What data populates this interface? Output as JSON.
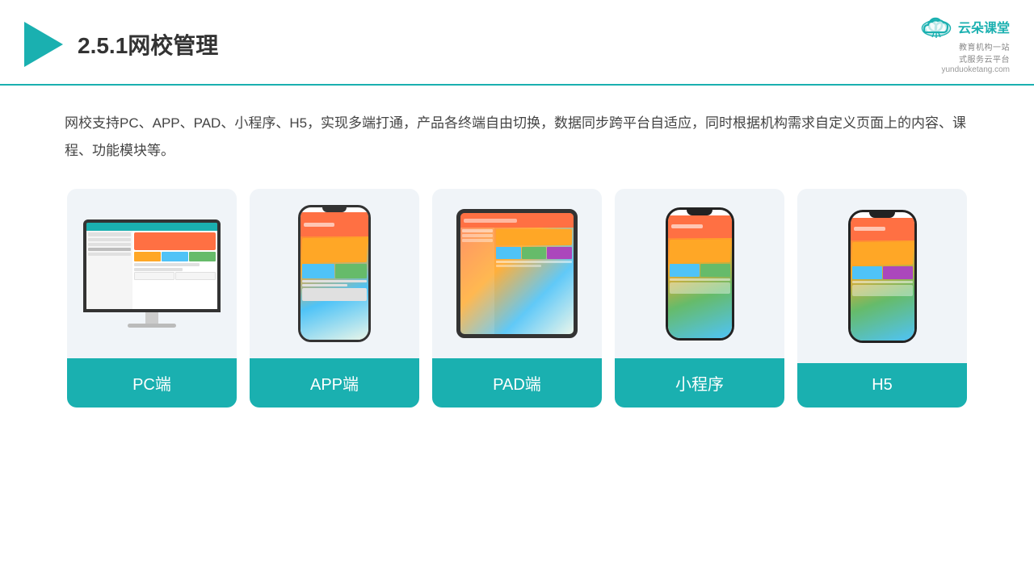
{
  "header": {
    "title": "2.5.1网校管理",
    "brand": {
      "name": "云朵课堂",
      "sub": "教育机构一站\n式服务云平台",
      "url": "yunduoketang.com"
    }
  },
  "description": "网校支持PC、APP、PAD、小程序、H5，实现多端打通，产品各终端自由切换，数据同步跨平台自适应，同时根据机构需求自定义页面上的内容、课程、功能模块等。",
  "cards": [
    {
      "id": "pc",
      "label": "PC端"
    },
    {
      "id": "app",
      "label": "APP端"
    },
    {
      "id": "pad",
      "label": "PAD端"
    },
    {
      "id": "miniprogram",
      "label": "小程序"
    },
    {
      "id": "h5",
      "label": "H5"
    }
  ],
  "colors": {
    "accent": "#1ab0b0",
    "bg_card": "#eef2f7",
    "text_dark": "#333333",
    "text_body": "#444444"
  }
}
